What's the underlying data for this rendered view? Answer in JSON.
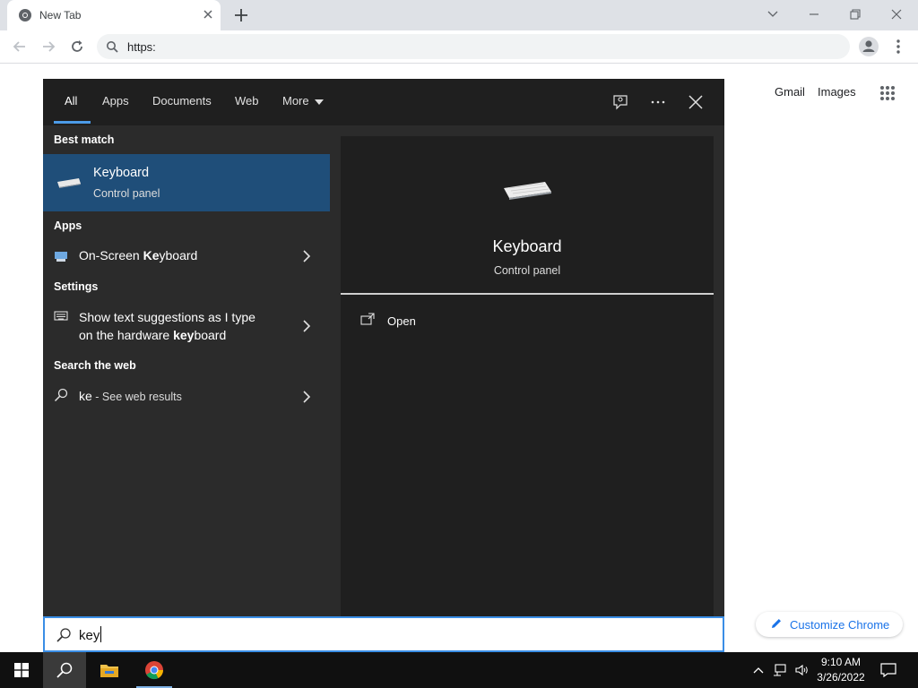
{
  "browser": {
    "tab_title": "New Tab",
    "address": "https:",
    "ntp_links": [
      "Gmail",
      "Images"
    ],
    "customize_label": "Customize Chrome"
  },
  "search_panel": {
    "filters": [
      "All",
      "Apps",
      "Documents",
      "Web",
      "More"
    ],
    "active_filter": "All",
    "sections": {
      "best_match": "Best match",
      "apps": "Apps",
      "settings": "Settings",
      "web": "Search the web"
    },
    "best_match": {
      "title": "Keyboard",
      "subtitle": "Control panel"
    },
    "apps": [
      {
        "pre": "On-Screen ",
        "bold": "Ke",
        "post": "yboard"
      }
    ],
    "settings": [
      {
        "line1": "Show text suggestions as I type",
        "pre2": "on the hardware ",
        "bold": "key",
        "post2": "board"
      }
    ],
    "web": {
      "query": "ke",
      "suffix": " - See web results"
    },
    "preview": {
      "title": "Keyboard",
      "subtitle": "Control panel",
      "action": "Open"
    },
    "search_input": "key"
  },
  "taskbar": {
    "time": "9:10 AM",
    "date": "3/26/2022"
  },
  "colors": {
    "accent": "#4c9be8",
    "selection": "#1f4e79",
    "panel_bg": "#2b2b2b"
  }
}
